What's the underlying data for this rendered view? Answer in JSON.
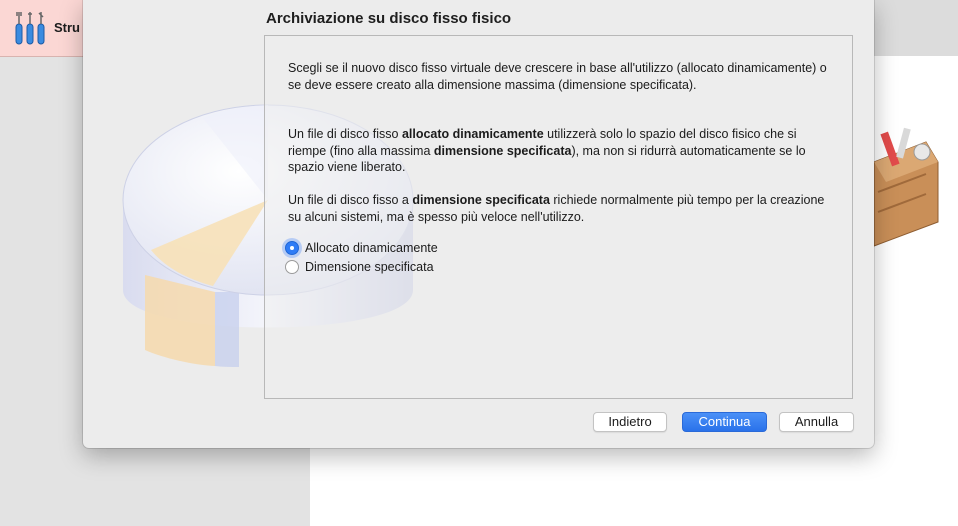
{
  "background": {
    "toolbar_label": "Stru"
  },
  "dialog": {
    "title": "Archiviazione su disco fisso fisico",
    "paragraphs": {
      "p1": "Scegli se il nuovo disco fisso virtuale deve crescere in base all'utilizzo (allocato dinamicamente) o se deve essere creato alla dimensione massima (dimensione specificata).",
      "p2": {
        "a": "Un file di disco fisso ",
        "b": "allocato dinamicamente",
        "c": " utilizzerà solo lo spazio del disco fisico che si riempe (fino alla massima ",
        "d": "dimensione specificata",
        "e": "), ma non si ridurrà automaticamente se lo spazio viene liberato."
      },
      "p3": {
        "a": "Un file di disco fisso a ",
        "b": "dimensione specificata",
        "c": " richiede normalmente più tempo per la creazione su alcuni sistemi, ma è spesso più veloce nell'utilizzo."
      }
    },
    "options": [
      {
        "label": "Allocato dinamicamente",
        "selected": true
      },
      {
        "label": "Dimensione specificata",
        "selected": false
      }
    ],
    "buttons": {
      "back": "Indietro",
      "next": "Continua",
      "cancel": "Annulla"
    }
  },
  "colors": {
    "accent": "#2f7cf6",
    "toolbar_bg": "#fbd7d4"
  }
}
